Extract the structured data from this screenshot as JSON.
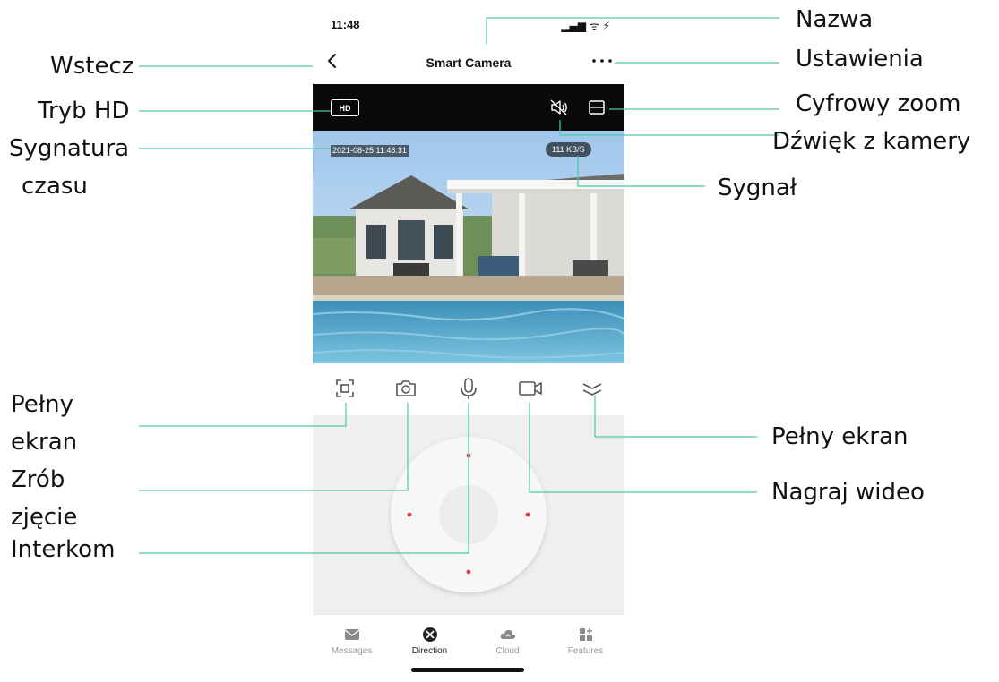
{
  "status_bar": {
    "time": "11:48",
    "icons": "▂▄▆ ᯤ ⚡"
  },
  "nav": {
    "back_icon": "chevron-left-icon",
    "title": "Smart Camera",
    "more_icon": "more-dots-icon"
  },
  "video_toolbar": {
    "hd_label": "HD",
    "sound_icon": "speaker-muted-icon",
    "zoom_icon": "zoom-frame-icon"
  },
  "video": {
    "timestamp": "2021-08-25 11:48:31",
    "speed": "111 KB/S"
  },
  "controls": [
    {
      "name": "fullscreen-icon"
    },
    {
      "name": "camera-icon"
    },
    {
      "name": "microphone-icon"
    },
    {
      "name": "video-camera-icon"
    },
    {
      "name": "collapse-icon"
    }
  ],
  "ptz": {
    "colors": {
      "pad": "#f7f7f7",
      "center": "#ececec",
      "dot": "#e23c3c"
    }
  },
  "tabs": [
    {
      "label": "Messages",
      "icon": "envelope-icon",
      "active": false
    },
    {
      "label": "Direction",
      "icon": "direction-icon",
      "active": true
    },
    {
      "label": "Cloud",
      "icon": "cloud-icon",
      "active": false
    },
    {
      "label": "Features",
      "icon": "grid-icon",
      "active": false
    }
  ],
  "annotations": {
    "wstecz": "Wstecz",
    "tryb_hd": "Tryb HD",
    "sygnatura_1": "Sygnatura",
    "sygnatura_2": "czasu",
    "pelny_ekran_1": "Pełny",
    "pelny_ekran_2": "ekran",
    "zrob_zdjecie_1": "Zrób",
    "zrob_zdjecie_2": "zjęcie",
    "interkom": "Interkom",
    "nazwa": "Nazwa",
    "ustawienia": "Ustawienia",
    "cyfrowy_zoom": "Cyfrowy zoom",
    "dzwiek": "Dźwięk z kamery",
    "sygnal": "Sygnał",
    "pelny_ekran_right": "Pełny ekran",
    "nagraj_wideo": "Nagraj wideo"
  },
  "colors": {
    "leader": "#4ec7a8",
    "accent_dot": "#e23c3c"
  }
}
